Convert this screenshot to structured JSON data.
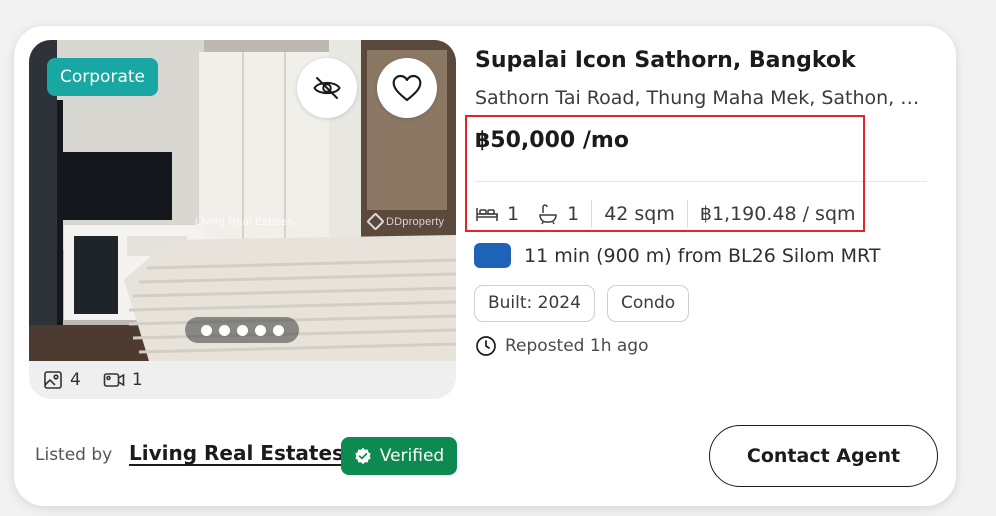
{
  "listing": {
    "badge": "Corporate",
    "watermark_agency": "Living Real Estates",
    "watermark_brand": "DDproperty",
    "media": {
      "photo_count": "4",
      "video_count": "1",
      "carousel_dots": 5,
      "active_dot": 1
    },
    "title": "Supalai Icon Sathorn, Bangkok",
    "address": "Sathorn Tai Road, Thung Maha Mek, Sathon, Bangkok",
    "price": "฿50,000 /mo",
    "features": {
      "bedrooms": "1",
      "bathrooms": "1",
      "area": "42 sqm",
      "price_per_sqm": "฿1,190.48 / sqm"
    },
    "transit": {
      "text": "11 min (900 m) from BL26 Silom MRT",
      "line_color": "#1e63b8"
    },
    "tags": [
      "Built: 2024",
      "Condo"
    ],
    "reposted": "Reposted 1h ago"
  },
  "footer": {
    "listed_by_label": "Listed by",
    "agency_name": "Living Real Estates",
    "verified_label": "Verified",
    "contact_button": "Contact Agent"
  },
  "colors": {
    "badge": "#18a7a2",
    "verified": "#0d8a4f",
    "highlight_border": "#e3252b"
  },
  "icons": [
    "eye-off-icon",
    "heart-icon",
    "photo-icon",
    "video-icon",
    "bed-icon",
    "bath-icon",
    "clock-icon",
    "verified-check-icon"
  ]
}
